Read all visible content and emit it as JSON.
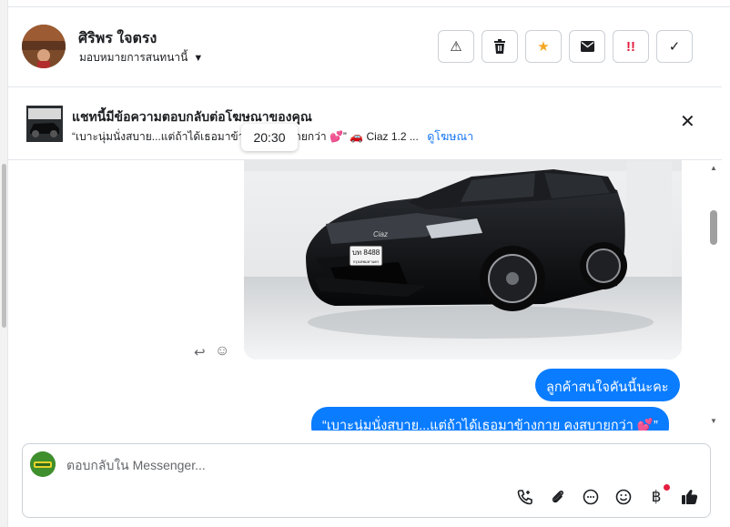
{
  "conversation": {
    "user_name": "ศิริพร ใจตรง",
    "assign_label": "มอบหมายการสนทนานี้"
  },
  "actions": [
    {
      "name": "report-button",
      "icon": "warning-icon",
      "glyph": "⚠"
    },
    {
      "name": "delete-button",
      "icon": "trash-icon",
      "glyph": "🗑"
    },
    {
      "name": "star-button",
      "icon": "star-icon",
      "glyph": "★"
    },
    {
      "name": "mark-unread-button",
      "icon": "envelope-icon",
      "glyph": "✉"
    },
    {
      "name": "follow-up-button",
      "icon": "exclamation-icon",
      "glyph": "‼"
    },
    {
      "name": "mark-done-button",
      "icon": "check-icon",
      "glyph": "✓"
    }
  ],
  "ad": {
    "title": "แชทนี้มีข้อความตอบกลับต่อโฆษณาของคุณ",
    "snippet": "“เบาะนุ่มนั่งสบาย...แต่ถ้าได้เธอมาข้างกายคงสบายกว่า 💕” 🚗 Ciaz 1.2 ...",
    "view_ad_label": "ดูโฆษณา"
  },
  "timestamp": "20:30",
  "messages": [
    {
      "text": "ลูกค้าสนใจคันนี้นะคะ"
    },
    {
      "text": "“เบาะนุ่มนั่งสบาย...แต่ถ้าได้เธอมาข้างกาย คงสบายกว่า 💕”"
    }
  ],
  "car_photo": {
    "plate_line1": "บท 8488",
    "plate_line2": "กรุงเทพมหานคร",
    "badge": "Ciaz"
  },
  "composer": {
    "placeholder": "ตอบกลับใน Messenger..."
  },
  "colors": {
    "accent": "#0a7cff",
    "link": "#1877f2",
    "urgent": "#e41e3f",
    "star": "#f5a623"
  }
}
